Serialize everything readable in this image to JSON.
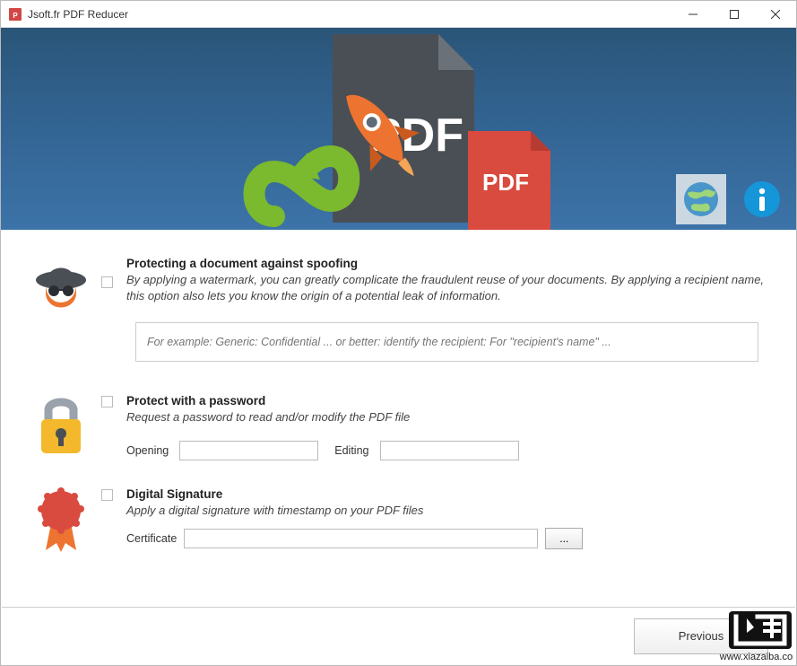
{
  "window": {
    "title": "Jsoft.fr PDF Reducer"
  },
  "header": {
    "pdf_badge_text": "PDF",
    "pdf_bg_text": "PDF"
  },
  "sections": {
    "watermark": {
      "heading": "Protecting a document against spoofing",
      "description": "By applying a watermark, you can greatly complicate the fraudulent reuse of your documents. By applying a recipient name, this option also lets you know the origin of a potential leak of information.",
      "placeholder": "For example: Generic: Confidential ... or better: identify the recipient: For \"recipient's name\" ..."
    },
    "password": {
      "heading": "Protect with a password",
      "description": "Request a password to read and/or modify the PDF file",
      "opening_label": "Opening",
      "editing_label": "Editing",
      "opening_value": "",
      "editing_value": ""
    },
    "signature": {
      "heading": "Digital Signature",
      "description": "Apply a digital signature with timestamp on your PDF files",
      "certificate_label": "Certificate",
      "certificate_value": "",
      "browse_label": "..."
    }
  },
  "footer": {
    "previous_label": "Previous"
  },
  "watermark_site": "www.xiazaiba.com"
}
